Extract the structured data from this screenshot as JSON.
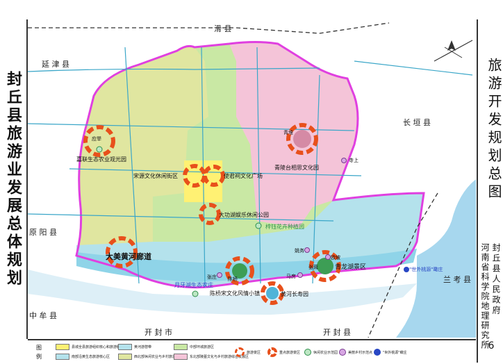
{
  "title_left": "封丘县旅游业发展总体规划",
  "title_right": "旅游开发规划总图",
  "org_line1": "封丘县人民政府",
  "org_line2": "河南省科学院地理研究所",
  "page_number": "6",
  "neighbors": {
    "north": "滑 县",
    "northwest": "延 津 县",
    "east": "长 垣 县",
    "west": "原 阳 县",
    "southwest": "中 牟 县",
    "south_left": "开 封 市",
    "south_right": "开 封 县",
    "southeast": "兰 考 县"
  },
  "places": {
    "yingju": "应举",
    "qingdui": "青堆",
    "siji": "寺上",
    "zhangzhuang": "张庄",
    "chenqiao": "陈桥",
    "mafang": "马房",
    "yaowu": "姚务",
    "shizhuang": "欧坡",
    "zhangzhuang2": "张茸"
  },
  "labels": {
    "eco_park": "嘉联生态农业观光园",
    "song_street": "宋源文化休闲街区",
    "shijun_plaza": "使君祠文化广场",
    "dagong_park": "大功湖娱乐休闲公园",
    "qingling_garden": "青陵台相思文化园",
    "flower_base": "梓钰花卉种植园",
    "huanghe_corridor": "大美黄河廊道",
    "qinglong_lake": "青龙湖景区",
    "yueya_village": "月牙湖生态农庄",
    "chenqiao_town": "陈桥宋文化风情小镇",
    "longevity_park": "黄河长寿园",
    "world_longevity": "\"世外桃源\"瞰庄"
  },
  "legend": {
    "title": "图 例",
    "items": [
      "县城全县旅游组织核心和旅游服务中心",
      "黄河游憩带",
      "中部环城旅游区",
      "南部沿黄生态旅游核心区",
      "西北部休闲农业与乡村旅游发展区",
      "东北部陵墓文化与乡村旅游综合发展区",
      "旅游景区",
      "重点旅游景区",
      "休闲农业示范园",
      "美丽乡村示范点",
      "\"世外桃源\"瞰庄"
    ]
  },
  "colors": {
    "northwest_zone": "#e0e6a0",
    "northeast_zone": "#f4c4d8",
    "central_zone": "#c9e8a4",
    "south_zone": "#b4e2ec",
    "yellow_river_band": "#8fd4e8",
    "county_core": "#fff173",
    "county_boundary": "#e040e0",
    "scenic_ring": "#e8501b"
  }
}
